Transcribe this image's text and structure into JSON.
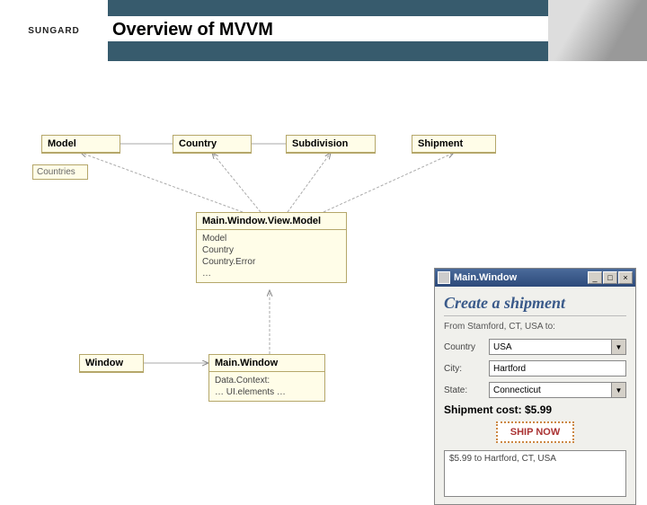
{
  "header": {
    "brand": "SUNGARD",
    "title": "Overview of MVVM"
  },
  "diagram": {
    "model": {
      "title": "Model",
      "field": "Countries"
    },
    "country": {
      "title": "Country"
    },
    "subdivision": {
      "title": "Subdivision"
    },
    "shipment": {
      "title": "Shipment"
    },
    "viewmodel": {
      "title": "Main.Window.View.Model",
      "lines": [
        "Model",
        "Country",
        "Country.Error",
        "…"
      ]
    },
    "window": {
      "title": "Window"
    },
    "mainwindow": {
      "title": "Main.Window",
      "lines": [
        "Data.Context:",
        "… UI.elements …"
      ]
    }
  },
  "app": {
    "window_title": "Main.Window",
    "heading": "Create a shipment",
    "from_text": "From Stamford, CT, USA to:",
    "fields": {
      "country_label": "Country",
      "country_value": "USA",
      "city_label": "City:",
      "city_value": "Hartford",
      "state_label": "State:",
      "state_value": "Connecticut"
    },
    "cost_label": "Shipment cost: $5.99",
    "ship_button": "SHIP NOW",
    "result": "$5.99 to Hartford, CT, USA"
  }
}
